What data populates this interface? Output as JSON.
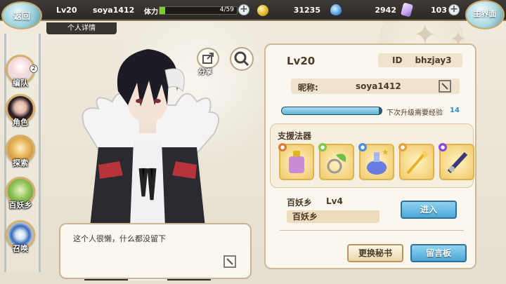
{
  "topbar": {
    "back_label": "返回",
    "level": "Lv20",
    "player_name": "soya1412",
    "stamina_label": "体力",
    "stamina_text": "4/59",
    "stamina_fraction": 0.07,
    "gold": "31235",
    "water": "2942",
    "crystal": "103",
    "home_label": "主界面"
  },
  "tab": {
    "label": "个人详情"
  },
  "sidebar": {
    "items": [
      {
        "label": "编队",
        "badge": "2"
      },
      {
        "label": "角色"
      },
      {
        "label": "探索"
      },
      {
        "label": "百妖乡"
      },
      {
        "label": "召唤"
      }
    ]
  },
  "actions": {
    "share_label": "分享"
  },
  "signature": {
    "text": "这个人很懒，什么都没留下"
  },
  "profile": {
    "level": "Lv20",
    "id_label": "ID",
    "id_value": "bhzjay3",
    "nick_label": "昵称:",
    "nick_value": "soya1412",
    "exp_label": "下次升级需要经验",
    "exp_value": "14",
    "exp_fraction": 0.97,
    "support_title": "支援法器",
    "town_name": "百妖乡",
    "town_level": "Lv4",
    "town_bar_text": "百妖乡",
    "enter_label": "进入",
    "change_secretary_label": "更换秘书",
    "message_board_label": "留言板"
  },
  "colors": {
    "topbar": "#2c2825",
    "panel": "#fbf7ee",
    "accent_blue": "#4ca7d6",
    "gold_border": "#e0b24e"
  }
}
